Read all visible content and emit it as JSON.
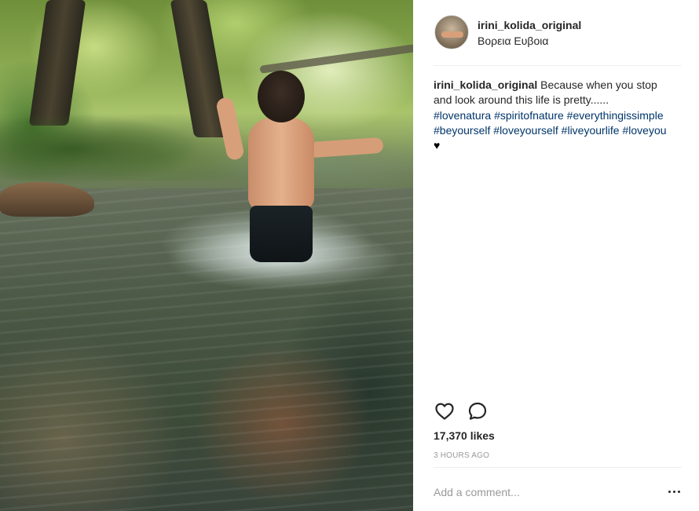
{
  "post": {
    "photo_alt": "Child walking through a stream in a sunlit forest",
    "header": {
      "username": "irini_kolida_original",
      "location": "Βορεια Ευβοια"
    },
    "caption": {
      "username": "irini_kolida_original",
      "text": "Because when you stop and look around this life is pretty......",
      "hashtags": [
        "#lovenatura",
        "#spiritofnature",
        "#everythingissimple",
        "#beyourself",
        "#loveyourself",
        "#liveyourlife",
        "#loveyou"
      ],
      "emoji": "♥"
    },
    "actions": {
      "like_icon": "heart-outline-icon",
      "comment_icon": "speech-bubble-icon"
    },
    "likes": "17,370 likes",
    "time": "3 HOURS AGO",
    "comment": {
      "placeholder": "Add a comment...",
      "value": ""
    },
    "more_icon": "more-options-icon"
  },
  "colors": {
    "hashtag": "#003569",
    "text": "#262626",
    "muted": "#999999",
    "divider": "#efefef"
  }
}
